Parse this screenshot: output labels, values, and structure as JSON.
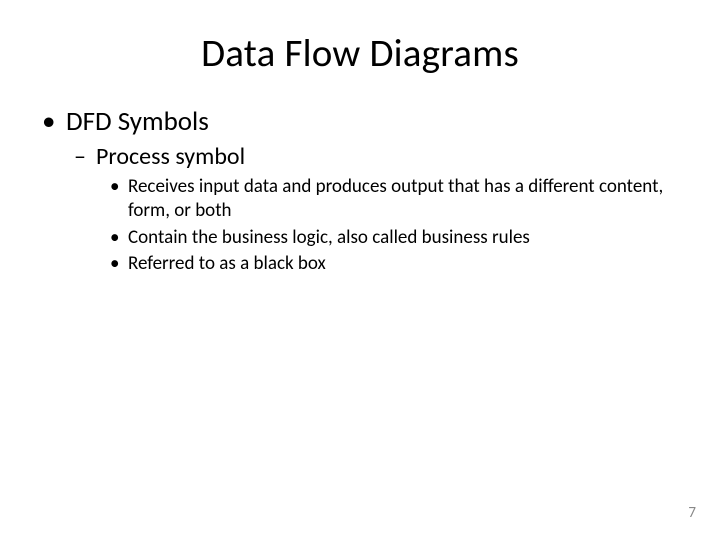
{
  "title": "Data Flow Diagrams",
  "lvl1": {
    "item0": "DFD Symbols"
  },
  "lvl2": {
    "item0": "Process symbol"
  },
  "lvl3": {
    "item0": "Receives input data and produces output that has a different content, form, or both",
    "item1": "Contain the business logic, also called business rules",
    "item2": "Referred to as a black box"
  },
  "pageNumber": "7"
}
